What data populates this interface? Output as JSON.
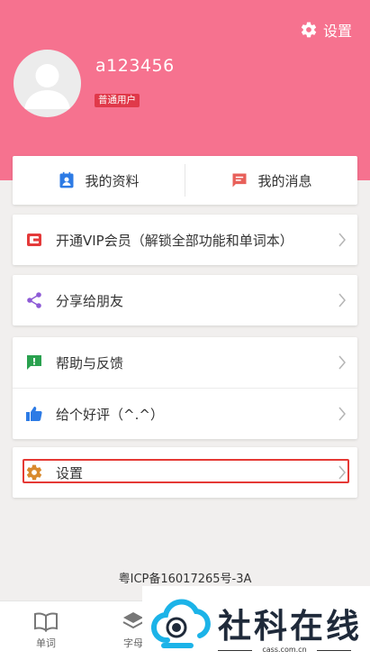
{
  "header": {
    "settings_label": "设置",
    "username": "a123456",
    "badge": "普通用户",
    "background_color": "#f6728f"
  },
  "profile_card": {
    "my_profile_label": "我的资料",
    "my_messages_label": "我的消息"
  },
  "menu": {
    "vip": {
      "label": "开通VIP会员（解锁全部功能和单词本）",
      "icon": "vip-card-icon"
    },
    "share": {
      "label": "分享给朋友",
      "icon": "share-icon"
    },
    "feedback": {
      "label": "帮助与反馈",
      "icon": "feedback-icon"
    },
    "rate": {
      "label": "给个好评（^.^）",
      "icon": "thumbs-up-icon"
    },
    "settings": {
      "label": "设置",
      "icon": "gear-icon"
    }
  },
  "footer": {
    "icp": "粤ICP备16017265号-3A"
  },
  "bottom_nav": {
    "items": [
      {
        "label": "单词",
        "icon": "book-icon"
      },
      {
        "label": "字母",
        "icon": "layers-icon"
      }
    ]
  },
  "watermark": {
    "title": "社科在线",
    "url": "cass.com.cn"
  }
}
